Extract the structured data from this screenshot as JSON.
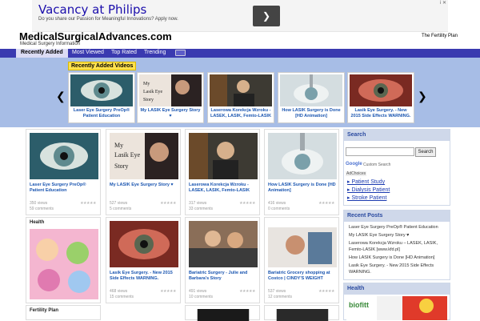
{
  "ad": {
    "headline": "Vacancy at Philips",
    "sub": "Do you share our Passion for Meaningful Innovations? Apply now.",
    "marker": "i ✕"
  },
  "site": {
    "title": "MedicalSurgicalAdvances.com",
    "tagline": "Medical Surgery Information",
    "top_right": "The Fertility Plan"
  },
  "nav": [
    "Recently Added",
    "Most Viewed",
    "Top Rated",
    "Trending"
  ],
  "slider": {
    "label": "Recently Added Videos",
    "items": [
      "Laser Eye Surgery PreOp® Patient Education",
      "My LASIK Eye Surgery Story ♥",
      "Laserowa Korekcja Wzroku - LASEK, LASIK, Femto-LASIK",
      "How LASIK Surgery is Done [HD Animation]",
      "Lasik Eye Surgery. - New 2015 Side Effects WARNING."
    ]
  },
  "cards": [
    {
      "title": "Laser Eye Surgery PreOp® Patient Education",
      "views": "350 views",
      "comments": "59 comments"
    },
    {
      "title": "My LASIK Eye Surgery Story ♥",
      "views": "527 views",
      "comments": "5 comments"
    },
    {
      "title": "Laserowa Korekcja Wzroku - LASEK, LASIK, Femto-LASIK",
      "views": "317 views",
      "comments": "33 comments"
    },
    {
      "title": "How LASIK Surgery is Done [HD Animation]",
      "views": "416 views",
      "comments": "0 comments"
    },
    {
      "title": "Lasik Eye Surgery. - New 2015 Side Effects WARNING.",
      "views": "468 views",
      "comments": "15 comments"
    },
    {
      "title": "Bariatric Surgery - Julie and Barbara's Story",
      "views": "491 views",
      "comments": "10 comments"
    },
    {
      "title": "Bariatric Grocery shopping at Costco | CINDY'S WEIGHT",
      "views": "537 views",
      "comments": "12 comments"
    }
  ],
  "left_boxes": {
    "health": "Health",
    "fertility": "Fertility Plan"
  },
  "sidebar": {
    "search_title": "Search",
    "search_button": "Search",
    "custom_search": "Custom Search",
    "google": "Google",
    "adchoices": "AdChoices",
    "links": [
      "▸ Patient Study",
      "▸ Dialysis Patient",
      "▸ Stroke Patient"
    ],
    "recent_title": "Recent Posts",
    "recent": [
      "Laser Eye Surgery PreOp® Patient Education",
      "My LASIK Eye Surgery Story ♥",
      "Laserowa Korekcja Wzroku – LASEK, LASIK, Femto-LASIK [www.kfd.pl]",
      "How LASIK Surgery is Done [HD Animation]",
      "Lasik Eye Surgery. - New 2015 Side Effects WARNING."
    ],
    "health_title": "Health"
  },
  "colors": {
    "nav": "#3a3ab0",
    "slider": "#a7bde6",
    "link": "#1a55b0"
  }
}
